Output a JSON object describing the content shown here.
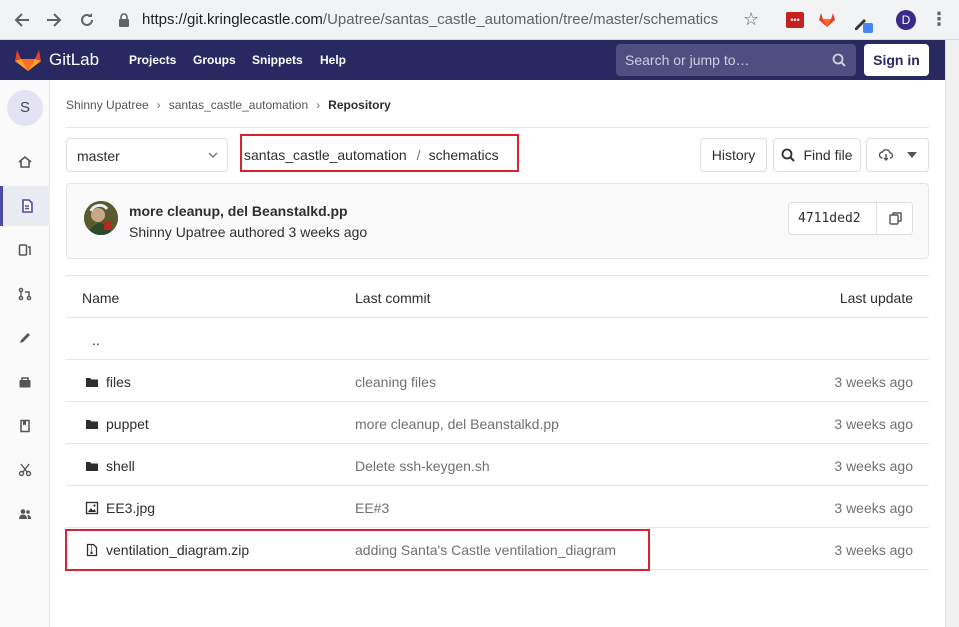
{
  "browser": {
    "url_host": "https://git.kringlecastle.com",
    "url_path": "/Upatree/santas_castle_automation/tree/master/schematics",
    "profile_initial": "D"
  },
  "header": {
    "brand": "GitLab",
    "nav": [
      "Projects",
      "Groups",
      "Snippets",
      "Help"
    ],
    "search_placeholder": "Search or jump to…",
    "sign_in": "Sign in"
  },
  "sidebar": {
    "avatar_initial": "S",
    "items": [
      "project-icon",
      "repository-icon",
      "issues-icon",
      "merge-requests-icon",
      "ci-cd-icon",
      "operations-icon",
      "wiki-icon",
      "snippets-icon",
      "members-icon"
    ]
  },
  "breadcrumb": {
    "items": [
      "Shinny Upatree",
      "santas_castle_automation",
      "Repository"
    ]
  },
  "toolbar": {
    "branch": "master",
    "path_root": "santas_castle_automation",
    "path_sep": "/",
    "path_dir": "schematics",
    "history_label": "History",
    "find_file_label": "Find file"
  },
  "commit": {
    "title": "more cleanup, del Beanstalkd.pp",
    "author_meta": "Shinny Upatree authored 3 weeks ago",
    "sha": "4711ded2"
  },
  "table": {
    "headers": {
      "name": "Name",
      "last_commit": "Last commit",
      "last_update": "Last update"
    },
    "parent_dir": "..",
    "rows": [
      {
        "type": "folder",
        "name": "files",
        "commit": "cleaning files",
        "updated": "3 weeks ago"
      },
      {
        "type": "folder",
        "name": "puppet",
        "commit": "more cleanup, del Beanstalkd.pp",
        "updated": "3 weeks ago"
      },
      {
        "type": "folder",
        "name": "shell",
        "commit": "Delete ssh-keygen.sh",
        "updated": "3 weeks ago"
      },
      {
        "type": "image",
        "name": "EE3.jpg",
        "commit": "EE#3",
        "updated": "3 weeks ago"
      },
      {
        "type": "archive",
        "name": "ventilation_diagram.zip",
        "commit": "adding Santa's Castle ventilation_diagram",
        "updated": "3 weeks ago"
      }
    ]
  },
  "colors": {
    "header_bg": "#292961",
    "highlight": "#d9232e"
  }
}
